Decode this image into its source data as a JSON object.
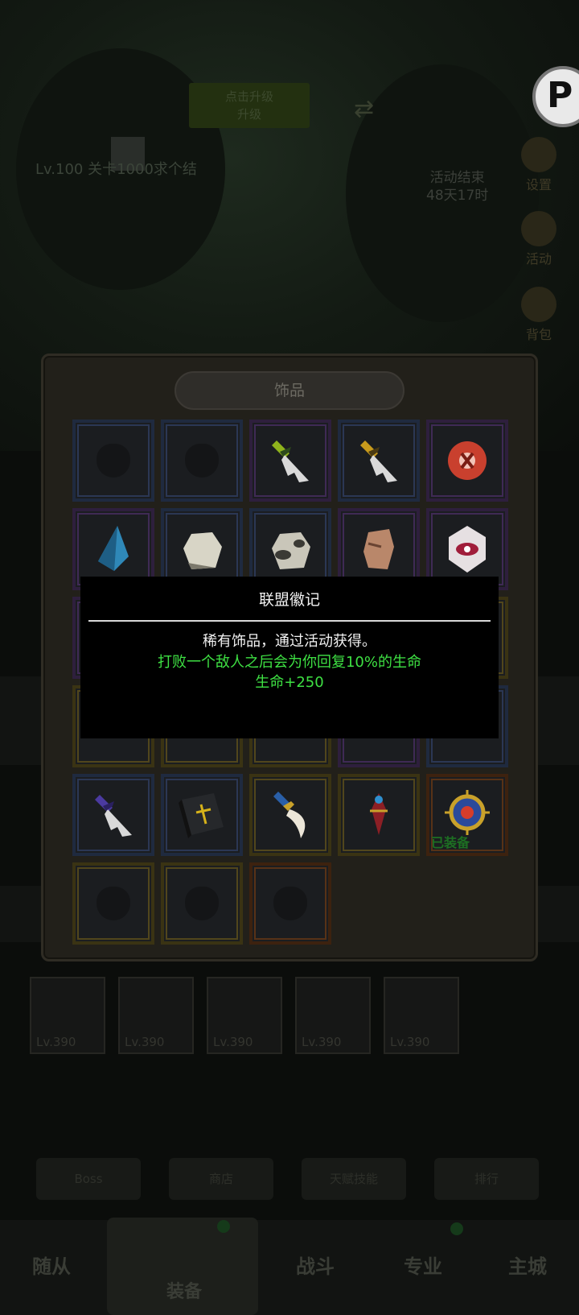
{
  "background": {
    "banner_line1": "点击升级",
    "banner_line2": "升级",
    "player_level": "Lv.100 关卡1000求个结",
    "timer_line1": "活动结束",
    "timer_line2": "48天17时",
    "right_buttons": [
      {
        "label": "设置",
        "icon": "gear-icon"
      },
      {
        "label": "活动",
        "icon": "gift-icon"
      },
      {
        "label": "背包",
        "icon": "bag-icon"
      }
    ],
    "corner_badge": "P",
    "small_cards": [
      "Lv.390",
      "Lv.390",
      "Lv.390",
      "Lv.390",
      "Lv.390"
    ],
    "pills": [
      "Boss",
      "商店",
      "天赋技能",
      "排行"
    ],
    "nav": {
      "left": "随从",
      "center": "装备",
      "battle": "战斗",
      "profession": "专业",
      "main": "主城"
    }
  },
  "panel": {
    "title": "饰品",
    "equipped_label": "已装备",
    "slots": [
      {
        "rarity": "blue",
        "item": "empty",
        "equipped": false
      },
      {
        "rarity": "blue",
        "item": "empty",
        "equipped": false
      },
      {
        "rarity": "purple",
        "item": "green-dagger",
        "equipped": false
      },
      {
        "rarity": "blue",
        "item": "gold-dagger",
        "equipped": false
      },
      {
        "rarity": "purple",
        "item": "red-orb",
        "equipped": false
      },
      {
        "rarity": "purple",
        "item": "blue-crystal",
        "equipped": false
      },
      {
        "rarity": "blue",
        "item": "white-stone",
        "equipped": false
      },
      {
        "rarity": "blue",
        "item": "spotted-stone",
        "equipped": false
      },
      {
        "rarity": "purple",
        "item": "clay-idol",
        "equipped": false
      },
      {
        "rarity": "purple",
        "item": "eye-emblem",
        "equipped": false
      },
      {
        "rarity": "purple",
        "item": "hidden",
        "equipped": false
      },
      {
        "rarity": "purple",
        "item": "hidden",
        "equipped": false
      },
      {
        "rarity": "gold",
        "item": "hidden",
        "equipped": false
      },
      {
        "rarity": "gold",
        "item": "hidden",
        "equipped": false
      },
      {
        "rarity": "gold",
        "item": "hidden",
        "equipped": false
      },
      {
        "rarity": "gold",
        "item": "hidden",
        "equipped": false
      },
      {
        "rarity": "gold",
        "item": "hidden",
        "equipped": false
      },
      {
        "rarity": "gold",
        "item": "hidden",
        "equipped": false
      },
      {
        "rarity": "purple",
        "item": "hidden",
        "equipped": false
      },
      {
        "rarity": "blue",
        "item": "hidden",
        "equipped": false
      },
      {
        "rarity": "blue",
        "item": "purple-dagger",
        "equipped": false
      },
      {
        "rarity": "blue",
        "item": "rune-book",
        "equipped": false
      },
      {
        "rarity": "gold",
        "item": "fang-dagger",
        "equipped": false
      },
      {
        "rarity": "gold",
        "item": "gem-amulet",
        "equipped": false
      },
      {
        "rarity": "orange",
        "item": "alliance-badge",
        "equipped": true
      },
      {
        "rarity": "gold",
        "item": "empty",
        "equipped": false
      },
      {
        "rarity": "gold",
        "item": "empty",
        "equipped": false
      },
      {
        "rarity": "orange",
        "item": "empty",
        "equipped": false
      }
    ]
  },
  "tooltip": {
    "name": "联盟徽记",
    "description": "稀有饰品，通过活动获得。",
    "effect": "打败一个敌人之后会为你回复10%的生命",
    "stat": "生命+250"
  }
}
